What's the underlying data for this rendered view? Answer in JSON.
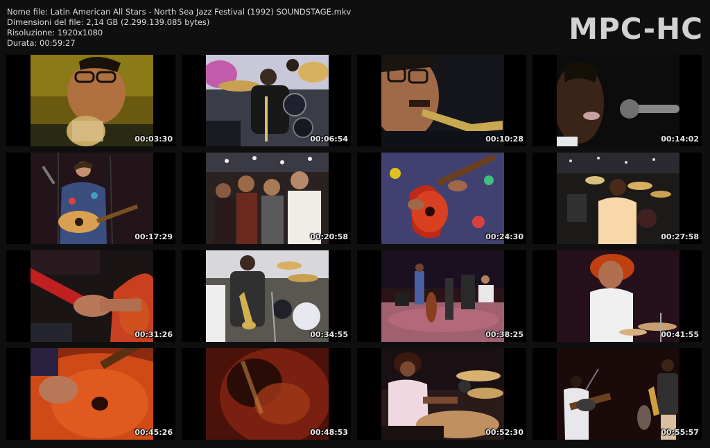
{
  "file_info": {
    "name_line": "Nome file: Latin American All Stars - North Sea Jazz Festival (1992) SOUNDSTAGE.mkv",
    "size_line": "Dimensioni del file: 2,14 GB (2.299.139.085 bytes)",
    "resolution_line": "Risoluzione: 1920x1080",
    "duration_line": "Durata: 00:59:27"
  },
  "logo": "MPC-HC",
  "thumbnails": [
    {
      "timestamp": "00:03:30",
      "bg": "#6a5a10"
    },
    {
      "timestamp": "00:06:54",
      "bg": "#3a3d48"
    },
    {
      "timestamp": "00:10:28",
      "bg": "#15151c"
    },
    {
      "timestamp": "00:14:02",
      "bg": "#0c0c0c"
    },
    {
      "timestamp": "00:17:29",
      "bg": "#1a0f12"
    },
    {
      "timestamp": "00:20:58",
      "bg": "#2a2220"
    },
    {
      "timestamp": "00:24:30",
      "bg": "#4a3a58"
    },
    {
      "timestamp": "00:27:58",
      "bg": "#1c1a18"
    },
    {
      "timestamp": "00:31:26",
      "bg": "#1a1414"
    },
    {
      "timestamp": "00:34:55",
      "bg": "#5a5650"
    },
    {
      "timestamp": "00:38:25",
      "bg": "#2a1418"
    },
    {
      "timestamp": "00:41:55",
      "bg": "#1a0a10"
    },
    {
      "timestamp": "00:45:26",
      "bg": "#8a2a10"
    },
    {
      "timestamp": "00:48:53",
      "bg": "#4a1208"
    },
    {
      "timestamp": "00:52:30",
      "bg": "#2a1a1a"
    },
    {
      "timestamp": "00:55:57",
      "bg": "#1a0a0a"
    }
  ]
}
